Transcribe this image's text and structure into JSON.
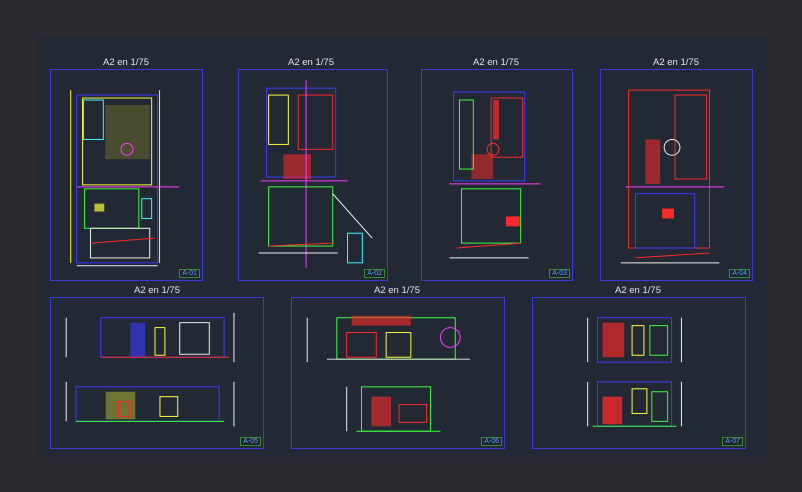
{
  "viewport": {
    "background": "#2b2a30",
    "modelspace": "#222834"
  },
  "sheets": [
    {
      "title": "A2 en 1/75",
      "code": "A-01",
      "kind": "plan"
    },
    {
      "title": "A2 en 1/75",
      "code": "A-02",
      "kind": "plan"
    },
    {
      "title": "A2 en 1/75",
      "code": "A-03",
      "kind": "plan"
    },
    {
      "title": "A2 en 1/75",
      "code": "A-04",
      "kind": "plan"
    },
    {
      "title": "A2 en 1/75",
      "code": "A-05",
      "kind": "elevation"
    },
    {
      "title": "A2 en 1/75",
      "code": "A-06",
      "kind": "elevation"
    },
    {
      "title": "A2 en 1/75",
      "code": "A-07",
      "kind": "elevation"
    }
  ],
  "colors": {
    "frame": "#3a3ad8",
    "wall_red": "#ff2a2a",
    "magenta": "#ff3cff",
    "yellow": "#ffff3c",
    "green": "#3cff3c",
    "cyan": "#3cffff",
    "white": "#f0f0f0",
    "blue": "#3c3cff"
  }
}
